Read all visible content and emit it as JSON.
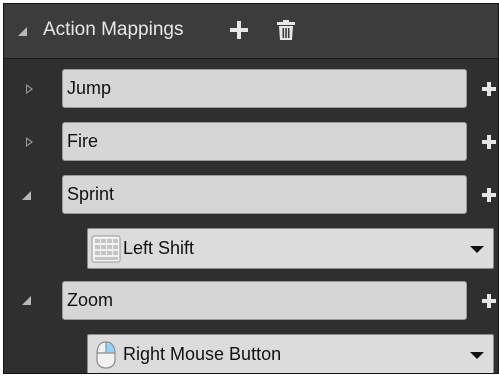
{
  "section": {
    "title": "Action Mappings",
    "add_icon": "plus-icon",
    "delete_icon": "trash-icon"
  },
  "mappings": [
    {
      "name": "Jump",
      "expanded": false
    },
    {
      "name": "Fire",
      "expanded": false
    },
    {
      "name": "Sprint",
      "expanded": true,
      "key": {
        "label": "Left Shift",
        "icon": "keyboard-icon"
      }
    },
    {
      "name": "Zoom",
      "expanded": true,
      "key": {
        "label": "Right Mouse Button",
        "icon": "mouse-icon"
      }
    }
  ],
  "colors": {
    "panel_bg": "#2f2f2f",
    "header_bg": "#3c3c3c",
    "field_bg": "#d6d6d6",
    "text_light": "#e6e6e6"
  }
}
